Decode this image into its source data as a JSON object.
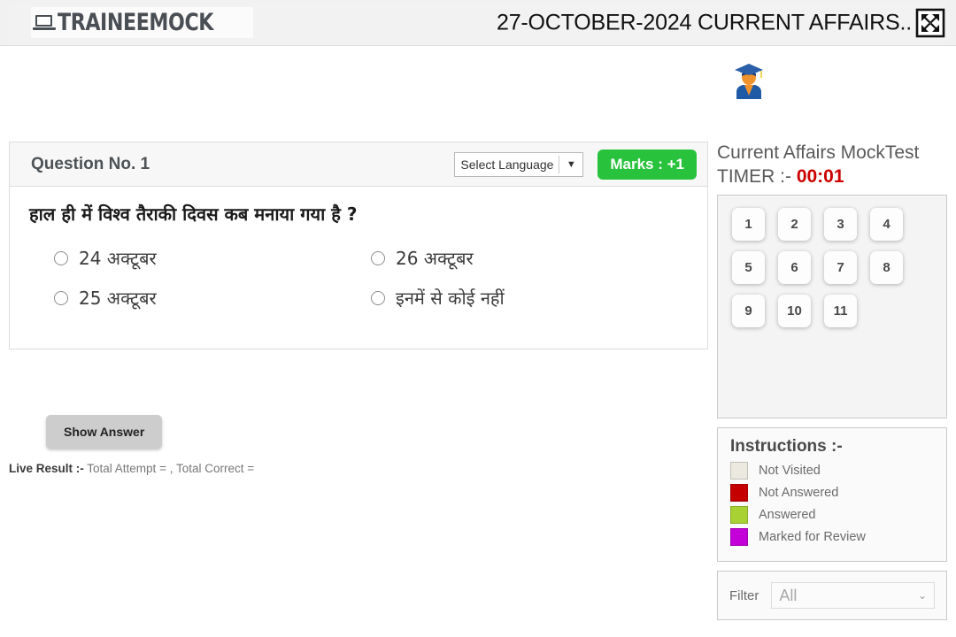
{
  "header": {
    "brand": "TRAINEEMOCK",
    "brand_icon": "laptop-icon",
    "title": "27-OCTOBER-2024 CURRENT AFFAIRS..",
    "fullscreen_icon": "fullscreen-icon"
  },
  "avatar": {
    "icon": "graduate-student-icon"
  },
  "question_card": {
    "question_no_label": "Question No. 1",
    "language_select": {
      "value": "Select Language",
      "caret": "▼"
    },
    "marks_badge": "Marks : +1",
    "question_text": "हाल ही में विश्व तैराकी दिवस कब मनाया गया है ?",
    "options": [
      {
        "label": "24 अक्टूबर"
      },
      {
        "label": "26 अक्टूबर"
      },
      {
        "label": "25 अक्टूबर"
      },
      {
        "label": "इनमें से कोई नहीं"
      }
    ]
  },
  "actions": {
    "show_answer_label": "Show Answer"
  },
  "live_result": {
    "prefix": "Live Result :-",
    "text": " Total Attempt = , Total Correct ="
  },
  "sidebar": {
    "test_title": "Current Affairs MockTest",
    "timer_label": "TIMER :- ",
    "timer_value": "00:01",
    "palette": [
      "1",
      "2",
      "3",
      "4",
      "5",
      "6",
      "7",
      "8",
      "9",
      "10",
      "11"
    ],
    "instructions": {
      "title": "Instructions :-",
      "legend": [
        {
          "label": "Not Visited",
          "color": "#ece9e0"
        },
        {
          "label": "Not Answered",
          "color": "#c40000"
        },
        {
          "label": "Answered",
          "color": "#a8d133"
        },
        {
          "label": "Marked for Review",
          "color": "#c400d8"
        }
      ]
    },
    "filter": {
      "label": "Filter",
      "value": "All",
      "caret": "⌄"
    }
  },
  "colors": {
    "accent_green": "#28c23c",
    "timer_red": "#cc0000",
    "brand_gray": "#4a4f55"
  }
}
